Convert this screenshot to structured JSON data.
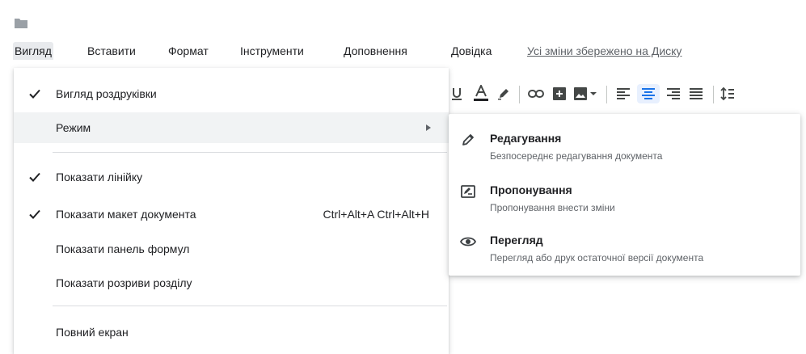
{
  "toolbar_icons": {
    "folder": "folder-icon",
    "underline": "underline-icon",
    "text_color": "text-color-icon",
    "highlight": "highlight-pen-icon",
    "link": "link-icon",
    "comment": "add-comment-icon",
    "image": "insert-image-icon",
    "align_left": "align-left-icon",
    "align_center": "align-center-icon",
    "align_right": "align-right-icon",
    "align_justify": "align-justify-icon",
    "line_spacing": "line-spacing-icon"
  },
  "menubar": {
    "items": [
      "Вигляд",
      "Вставити",
      "Формат",
      "Інструменти",
      "Доповнення",
      "Довідка"
    ],
    "save_status": "Усі зміни збережено на Диску"
  },
  "view_menu": {
    "print_layout": "Вигляд роздруківки",
    "mode": "Режим",
    "show_ruler": "Показати лінійку",
    "show_outline": "Показати макет документа",
    "shortcut": "Ctrl+Alt+A Ctrl+Alt+H",
    "show_equation_toolbar": "Показати панель формул",
    "show_section_breaks": "Показати розриви розділу",
    "full_screen": "Повний екран"
  },
  "mode_submenu": [
    {
      "title": "Редагування",
      "description": "Безпосереднє редагування документа",
      "icon": "pencil-icon"
    },
    {
      "title": "Пропонування",
      "description": "Пропонування внести зміни",
      "icon": "suggest-edit-icon"
    },
    {
      "title": "Перегляд",
      "description": "Перегляд або друк остаточної версії документа",
      "icon": "eye-icon"
    }
  ],
  "colors": {
    "text_color_underline": "#202124",
    "active_button_bg": "#e8f0fe",
    "active_icon": "#1a73e8",
    "hover_row": "#f1f3f4"
  }
}
